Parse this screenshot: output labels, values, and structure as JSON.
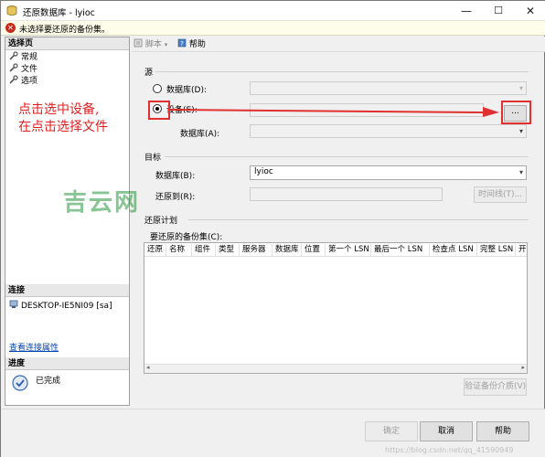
{
  "window": {
    "title": "还原数据库 - lyioc",
    "minimize": "—",
    "maximize": "☐",
    "close": "✕"
  },
  "error_bar": {
    "text": "未选择要还原的备份集。"
  },
  "left": {
    "select_page_header": "选择页",
    "pages": [
      "常规",
      "文件",
      "选项"
    ],
    "connection_header": "连接",
    "server": "DESKTOP-IE5NI09 [sa]",
    "view_connection_link": "查看连接属性",
    "progress_header": "进度",
    "progress_status": "已完成"
  },
  "toolbar": {
    "script_label": "脚本",
    "help_label": "帮助"
  },
  "source": {
    "header": "源",
    "database_radio": "数据库(D):",
    "device_radio": "设备(E):",
    "device_database_label": "数据库(A):",
    "browse_button": "..."
  },
  "target": {
    "header": "目标",
    "database_label": "数据库(B):",
    "database_value": "lyioc",
    "restore_to_label": "还原到(R):",
    "timeline_button": "时间线(T)..."
  },
  "plan": {
    "header": "还原计划",
    "backup_sets_label": "要还原的备份集(C):",
    "columns": [
      "还原",
      "名称",
      "组件",
      "类型",
      "服务器",
      "数据库",
      "位置",
      "第一个 LSN",
      "最后一个 LSN",
      "检查点 LSN",
      "完整 LSN",
      "开始"
    ]
  },
  "verify_button": "验证备份介质(V)",
  "buttons": {
    "ok": "确定",
    "cancel": "取消",
    "help": "帮助"
  },
  "annotation": {
    "line1": "点击选中设备,",
    "line2": "在点击选择文件"
  },
  "watermark": "吉云网",
  "credit": "https://blog.csdn.net/qq_41590949"
}
